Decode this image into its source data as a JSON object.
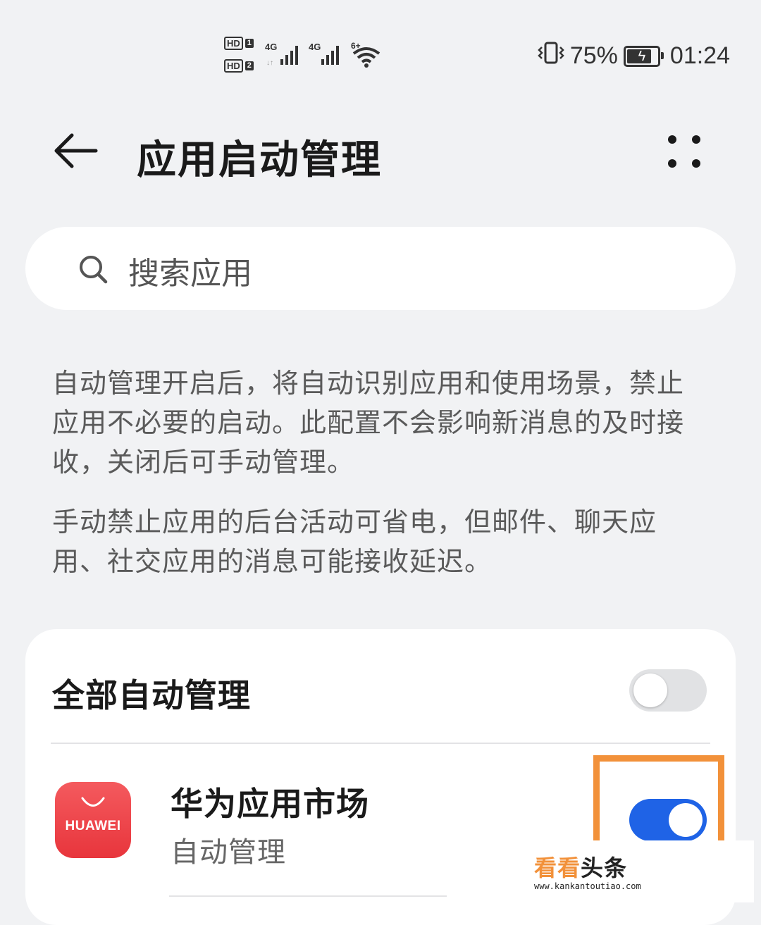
{
  "status_bar": {
    "hd1": "HD",
    "sim1": "1",
    "hd2": "HD",
    "sim2": "2",
    "network1": "4G",
    "network2": "4G",
    "wifi": "6+",
    "battery_percent": "75%",
    "time": "01:24",
    "icons": [
      "vibrate-icon",
      "battery-charging-icon",
      "wifi-icon",
      "signal-icon"
    ]
  },
  "header": {
    "title": "应用启动管理",
    "back_icon": "back-arrow-icon",
    "more_icon": "more-icon"
  },
  "search": {
    "placeholder": "搜索应用",
    "icon": "search-icon"
  },
  "description": {
    "paragraph1": "自动管理开启后，将自动识别应用和使用场景，禁止应用不必要的启动。此配置不会影响新消息的及时接收，关闭后可手动管理。",
    "paragraph2": "手动禁止应用的后台活动可省电，但邮件、聊天应用、社交应用的消息可能接收延迟。"
  },
  "settings": {
    "all_auto_manage": {
      "label": "全部自动管理",
      "enabled": false
    },
    "apps": [
      {
        "name": "华为应用市场",
        "status": "自动管理",
        "icon_text": "HUAWEI",
        "enabled": true
      }
    ]
  },
  "watermark": {
    "line1_a": "看看",
    "line1_b": "头条",
    "line2": "www.kankantoutiao.com"
  },
  "colors": {
    "background": "#f1f2f4",
    "toggle_on": "#1f63e6",
    "toggle_off": "#e1e2e4",
    "highlight": "#f2913a",
    "app_icon": "#e8353c"
  }
}
